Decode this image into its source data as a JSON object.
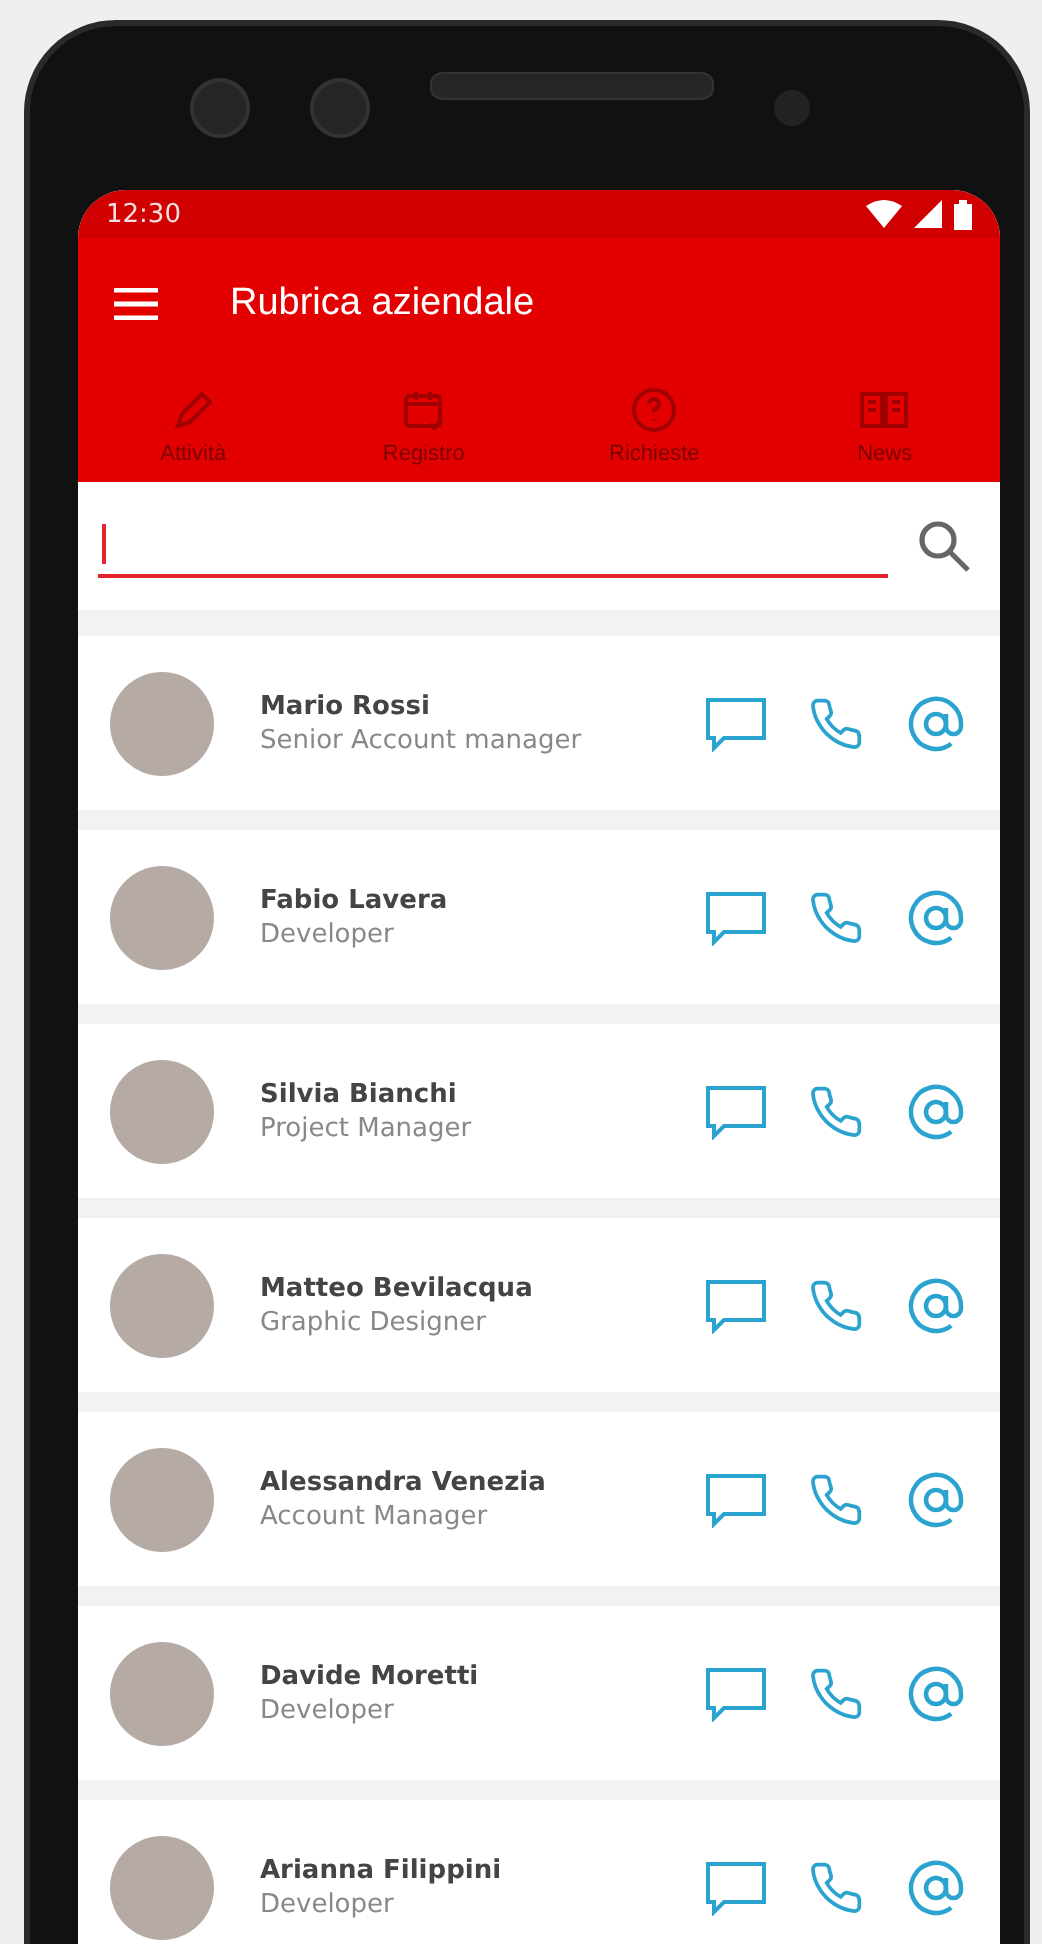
{
  "status_bar": {
    "time": "12:30"
  },
  "toolbar": {
    "title": "Rubrica aziendale"
  },
  "tabs": [
    {
      "label": "Attività",
      "kind": "pencil",
      "disabled": true
    },
    {
      "label": "Registro",
      "kind": "calendar",
      "disabled": true
    },
    {
      "label": "Richieste",
      "kind": "help",
      "disabled": true
    },
    {
      "label": "News",
      "kind": "book",
      "disabled": true
    }
  ],
  "search": {
    "focused": true
  },
  "contacts": [
    {
      "name": "Mario Rossi",
      "role": "Senior Account manager"
    },
    {
      "name": "Fabio Lavera",
      "role": "Developer"
    },
    {
      "name": "Silvia Bianchi",
      "role": "Project Manager"
    },
    {
      "name": "Matteo Bevilacqua",
      "role": "Graphic Designer"
    },
    {
      "name": "Alessandra Venezia",
      "role": "Account Manager"
    },
    {
      "name": "Davide Moretti",
      "role": "Developer"
    },
    {
      "name": "Arianna Filippini",
      "role": "Developer"
    }
  ]
}
